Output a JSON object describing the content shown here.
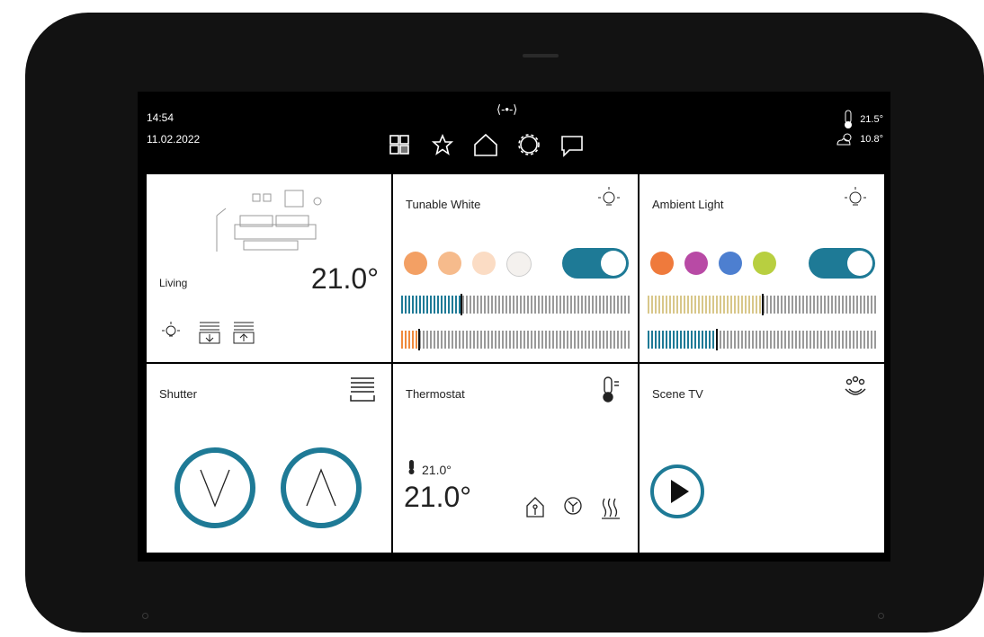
{
  "status": {
    "time": "14:54",
    "date": "11.02.2022",
    "handle": "⟨-•-⟩",
    "indoor_temp": "21.5°",
    "outdoor_temp": "10.8°"
  },
  "nav": [
    "rooms-icon",
    "favorites-icon",
    "home-icon",
    "settings-icon",
    "messages-icon"
  ],
  "living": {
    "label": "Living",
    "temp": "21.0°"
  },
  "tunable": {
    "title": "Tunable White",
    "toggle": "on",
    "slider1_level": 0.26,
    "slider2_level": 0.08
  },
  "ambient": {
    "title": "Ambient Light",
    "toggle": "on",
    "slider1_level": 0.5,
    "slider2_level": 0.3
  },
  "shutter": {
    "title": "Shutter"
  },
  "thermostat": {
    "title": "Thermostat",
    "setpoint": "21.0°",
    "current": "21.0°"
  },
  "scene": {
    "title": "Scene TV"
  },
  "colors": {
    "accent": "#1e7a96",
    "orange": "#f08a3c",
    "slider_yellow": "#d8c78a"
  }
}
